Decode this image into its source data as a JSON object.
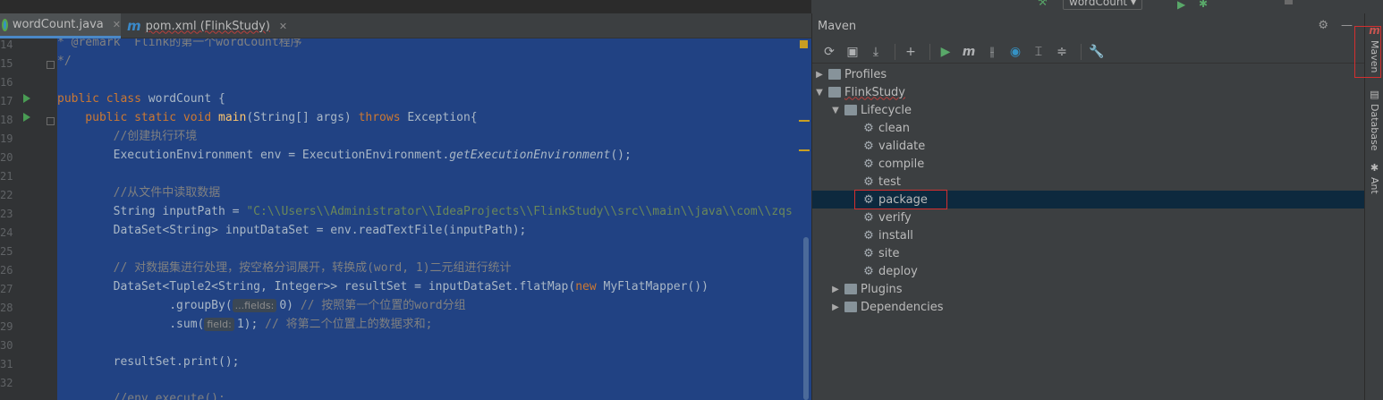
{
  "run_config": {
    "name": "wordCount"
  },
  "tabs": [
    {
      "label": "wordCount.java",
      "active": true
    },
    {
      "label": "pom.xml (FlinkStudy)",
      "active": false
    }
  ],
  "editor": {
    "line_numbers": [
      "14",
      "15",
      "16",
      "17",
      "18",
      "19",
      "20",
      "21",
      "22",
      "23",
      "24",
      "25",
      "26",
      "27",
      "28",
      "29",
      "30",
      "31",
      "32"
    ],
    "lines": {
      "l14": "* @remark  Flink的第一个wordCount程序",
      "l15": "*/",
      "l17a": "public class ",
      "l17b": "wordCount {",
      "l18a": "    public static void ",
      "l18b": "main",
      "l18c": "(String[] args) ",
      "l18d": "throws ",
      "l18e": "Exception{",
      "l19": "        //创建执行环境",
      "l20a": "        ExecutionEnvironment env = ExecutionEnvironment.",
      "l20b": "getExecutionEnvironment",
      "l20c": "();",
      "l22": "        //从文件中读取数据",
      "l23a": "        String inputPath = ",
      "l23b": "\"C:\\\\Users\\\\Administrator\\\\IdeaProjects\\\\FlinkStudy\\\\src\\\\main\\\\java\\\\com\\\\zqs",
      "l24": "        DataSet<String> inputDataSet = env.readTextFile(inputPath);",
      "l26": "        // 对数据集进行处理，按空格分词展开，转换成(word, 1)二元组进行统计",
      "l27a": "        DataSet<Tuple2<String, Integer>> resultSet = inputDataSet.flatMap(",
      "l27b": "new ",
      "l27c": "MyFlatMapper())",
      "l28a": "                .groupBy(",
      "l28hint": "...fields:",
      "l28b": "0) ",
      "l28c": "// 按照第一个位置的word分组",
      "l29a": "                .sum(",
      "l29hint": "field:",
      "l29b": "1); ",
      "l29c": "// 将第二个位置上的数据求和;",
      "l31": "        resultSet.print();",
      "l32": "        //env.execute();"
    }
  },
  "maven": {
    "title": "Maven",
    "tree": {
      "profiles": "Profiles",
      "project": "FlinkStudy",
      "lifecycle": "Lifecycle",
      "goals": [
        "clean",
        "validate",
        "compile",
        "test",
        "package",
        "verify",
        "install",
        "site",
        "deploy"
      ],
      "plugins": "Plugins",
      "dependencies": "Dependencies"
    },
    "selected_goal": "package"
  },
  "right_stripe": [
    "Maven",
    "Database",
    "Ant"
  ],
  "colors": {
    "accent": "#4a88c7",
    "selection": "#214283",
    "highlight_box": "#d32f2f"
  }
}
